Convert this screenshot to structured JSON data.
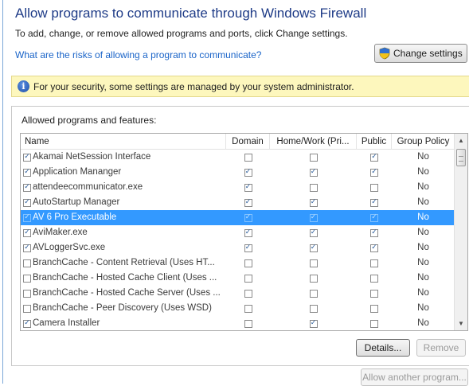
{
  "header": {
    "title": "Allow programs to communicate through Windows Firewall",
    "instructions": "To add, change, or remove allowed programs and ports, click Change settings.",
    "risks_link": "What are the risks of allowing a program to communicate?",
    "change_settings_label": "Change settings"
  },
  "info_bar": {
    "text": "For your security, some settings are managed by your system administrator."
  },
  "list": {
    "label": "Allowed programs and features:",
    "columns": [
      "Name",
      "Domain",
      "Home/Work (Pri...",
      "Public",
      "Group Policy"
    ],
    "rows": [
      {
        "name": "Akamai NetSession Interface",
        "enabled": true,
        "domain": false,
        "home": false,
        "public": true,
        "group_policy": "No",
        "selected": false
      },
      {
        "name": "Application Mananger",
        "enabled": true,
        "domain": true,
        "home": true,
        "public": true,
        "group_policy": "No",
        "selected": false
      },
      {
        "name": "attendeecommunicator.exe",
        "enabled": true,
        "domain": true,
        "home": false,
        "public": false,
        "group_policy": "No",
        "selected": false
      },
      {
        "name": "AutoStartup Manager",
        "enabled": true,
        "domain": true,
        "home": true,
        "public": true,
        "group_policy": "No",
        "selected": false
      },
      {
        "name": "AV 6 Pro Executable",
        "enabled": true,
        "domain": true,
        "home": true,
        "public": true,
        "group_policy": "No",
        "selected": true
      },
      {
        "name": "AviMaker.exe",
        "enabled": true,
        "domain": true,
        "home": true,
        "public": true,
        "group_policy": "No",
        "selected": false
      },
      {
        "name": "AVLoggerSvc.exe",
        "enabled": true,
        "domain": true,
        "home": true,
        "public": true,
        "group_policy": "No",
        "selected": false
      },
      {
        "name": "BranchCache - Content Retrieval (Uses HT...",
        "enabled": false,
        "domain": false,
        "home": false,
        "public": false,
        "group_policy": "No",
        "selected": false
      },
      {
        "name": "BranchCache - Hosted Cache Client (Uses ...",
        "enabled": false,
        "domain": false,
        "home": false,
        "public": false,
        "group_policy": "No",
        "selected": false
      },
      {
        "name": "BranchCache - Hosted Cache Server (Uses ...",
        "enabled": false,
        "domain": false,
        "home": false,
        "public": false,
        "group_policy": "No",
        "selected": false
      },
      {
        "name": "BranchCache - Peer Discovery (Uses WSD)",
        "enabled": false,
        "domain": false,
        "home": false,
        "public": false,
        "group_policy": "No",
        "selected": false
      },
      {
        "name": "Camera Installer",
        "enabled": true,
        "domain": false,
        "home": true,
        "public": false,
        "group_policy": "No",
        "selected": false
      }
    ]
  },
  "buttons": {
    "details": "Details...",
    "remove": "Remove",
    "allow_another": "Allow another program..."
  },
  "icons": {
    "change_settings": "uac-shield-icon",
    "info": "info-icon",
    "scroll_up": "scroll-up-icon",
    "scroll_down": "scroll-down-icon"
  },
  "colors": {
    "title": "#1e3b87",
    "link": "#1a64c8",
    "selection": "#3399ff",
    "info_bar": "#fdf7bd"
  }
}
